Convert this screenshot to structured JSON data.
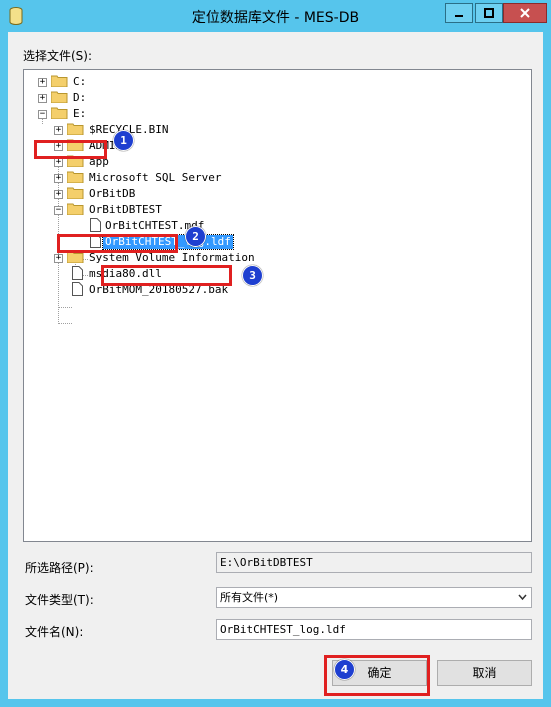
{
  "window": {
    "title": "定位数据库文件 - MES-DB"
  },
  "labels": {
    "select_file": "选择文件(S):",
    "selected_path": "所选路径(P):",
    "file_type": "文件类型(T):",
    "file_name": "文件名(N):"
  },
  "tree": {
    "drive_c": "C:",
    "drive_d": "D:",
    "drive_e": "E:",
    "items": {
      "recycle": "$RECYCLE.BIN",
      "admin": "ADMIN",
      "app": "app",
      "mssql": "Microsoft SQL Server",
      "orbitdb": "OrBitDB",
      "orbitdbtest": "OrBitDBTEST",
      "mdf": "OrBitCHTEST.mdf",
      "ldf": "OrBitCHTEST_log.ldf",
      "sysvol": "System Volume Information",
      "msdia": "msdia80.dll",
      "bak": "OrBitMOM_20180527.bak"
    },
    "expander_plus": "+",
    "expander_minus": "−"
  },
  "fields": {
    "selected_path_value": "E:\\OrBitDBTEST",
    "file_type_value": "所有文件(*)",
    "file_name_value": "OrBitCHTEST_log.ldf"
  },
  "buttons": {
    "ok": "确定",
    "cancel": "取消"
  },
  "callouts": {
    "one": "1",
    "two": "2",
    "three": "3",
    "four": "4"
  },
  "colors": {
    "title_bar": "#56c5ec",
    "selection": "#3399ff",
    "callout_box": "#e02020",
    "callout_badge": "#1e3fd0",
    "close_button": "#c75050"
  }
}
